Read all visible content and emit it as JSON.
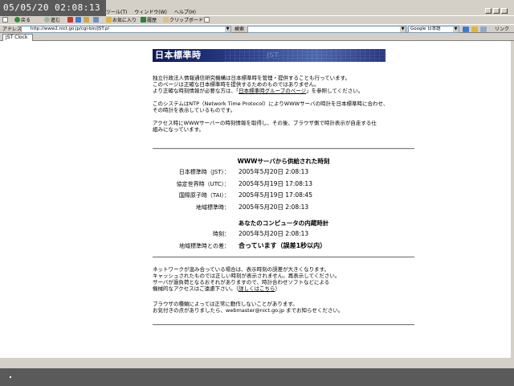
{
  "clock": {
    "text": "05/05/20 02:08:13"
  },
  "menu": {
    "items": [
      "ツール(T)",
      "ウィンドウ(W)",
      "ヘルプ(H)"
    ]
  },
  "toolbar": {
    "back_label": "戻る",
    "forward_label": "進む",
    "favorites_label": "お気に入り",
    "history_label": "履歴",
    "clipboard_label": "クリップボード"
  },
  "address_bar": {
    "label": "アドレス",
    "url": "http://www2.nict.go.jp/cgi-bin/JST.pl",
    "search_label": "検索",
    "search_engine": "Google 日本語",
    "links_label": "リンク"
  },
  "tabs": [
    {
      "label": "JST Clock"
    }
  ],
  "banner": {
    "title": "日本標準時",
    "subtitle": "JST"
  },
  "intro": {
    "lines": [
      "独立行政法人情報通信研究機構は日本標準時を管理・提供することも行っています。",
      "このページは正確な日本標準時を提供するためのものではありません。"
    ],
    "line3_prefix": "より正確な時刻情報が必要な方は、「",
    "line3_link": "日本標準時グループのページ",
    "line3_suffix": "」を参照してください。"
  },
  "ntp_note": {
    "lines": [
      "このシステムはNTP（Network Time Protocol）によりWWWサーバの時計を日本標準時に合わせ、",
      "その時計を表示しているものです。"
    ]
  },
  "access_note": {
    "lines": [
      "アクセス時にWWWサーバーの時刻情報を取得し、その後、ブラウザ側で時計表示が自走する仕",
      "組みになっています。"
    ]
  },
  "server_time": {
    "heading": "WWWサーバから供給された時刻",
    "rows": [
      {
        "label": "日本標準時（JST）：",
        "value": "2005年5月20日 2:08:13"
      },
      {
        "label": "協定世界時（UTC）：",
        "value": "2005年5月19日 17:08:13"
      },
      {
        "label": "国際原子時（TAI）：",
        "value": "2005年5月19日 17:08:45"
      },
      {
        "label": "地域標準時：",
        "value": "2005年5月20日 2:08:13"
      }
    ]
  },
  "local_time": {
    "heading": "あなたのコンピュータの内蔵時計",
    "rows": [
      {
        "label": "時刻：",
        "value": "2005年5月20日 2:08:13"
      },
      {
        "label": "地域標準時との差：",
        "value": "合っています（誤差1秒以内）"
      }
    ]
  },
  "network_note": {
    "lines": [
      "ネットワークが混み合っている場合は、表示時刻の誤差が大きくなります。",
      "キャッシュされたものでは正しい時刻が表示されません。再表示してください。",
      "サーバが過負荷となるおそれがありますので、時計合わせソフトなどによる"
    ],
    "line4_prefix": "機械的なアクセスはご遠慮下さい。（",
    "line4_link": "詳しくはこちら",
    "line4_suffix": "）"
  },
  "browser_note": {
    "lines": [
      "ブラウザの種類によっては正常に動作しないことがあります。",
      "お気付きの点がありましたら、webmaster@nict.go.jp までお知らせください。"
    ]
  },
  "colors": {
    "chrome": "#d4d0c8",
    "banner_dark": "#101a55",
    "banner_mid": "#4c67ad",
    "rule": "#808080",
    "clock_bg": "#5a5a5a"
  }
}
